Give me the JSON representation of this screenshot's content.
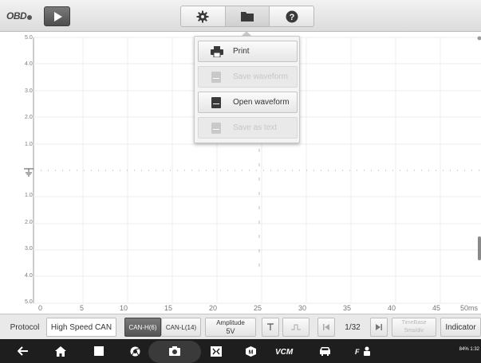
{
  "header": {
    "logo_text": "OBD",
    "tools": [
      {
        "icon": "gear-icon"
      },
      {
        "icon": "folder-icon"
      },
      {
        "icon": "help-icon"
      }
    ]
  },
  "plot": {
    "y_labels": [
      "5.0",
      "4.0",
      "3.0",
      "2.0",
      "1.0",
      "1.0",
      "2.0",
      "3.0",
      "4.0",
      "5.0"
    ],
    "x_labels": [
      "0",
      "5",
      "10",
      "15",
      "20",
      "25",
      "30",
      "35",
      "40",
      "45",
      "50ms"
    ]
  },
  "menu": {
    "items": [
      {
        "label": "Print",
        "enabled": true,
        "icon": "printer-icon"
      },
      {
        "label": "Save waveform",
        "enabled": false,
        "icon": "save-waveform-icon"
      },
      {
        "label": "Open waveform",
        "enabled": true,
        "icon": "open-waveform-icon"
      },
      {
        "label": "Save as text",
        "enabled": false,
        "icon": "save-text-icon"
      }
    ]
  },
  "controls": {
    "protocol_label": "Protocol",
    "protocol_value": "High Speed CAN",
    "can_h": "CAN-H(6)",
    "can_l": "CAN-L(14)",
    "amplitude_label": "Amplitude",
    "amplitude_value": "5V",
    "page": "1/32",
    "timebase_label": "TimeBase",
    "timebase_value": "5ms/div",
    "indicator": "Indicator"
  },
  "status_bar": {
    "text": "84% 1:32"
  }
}
